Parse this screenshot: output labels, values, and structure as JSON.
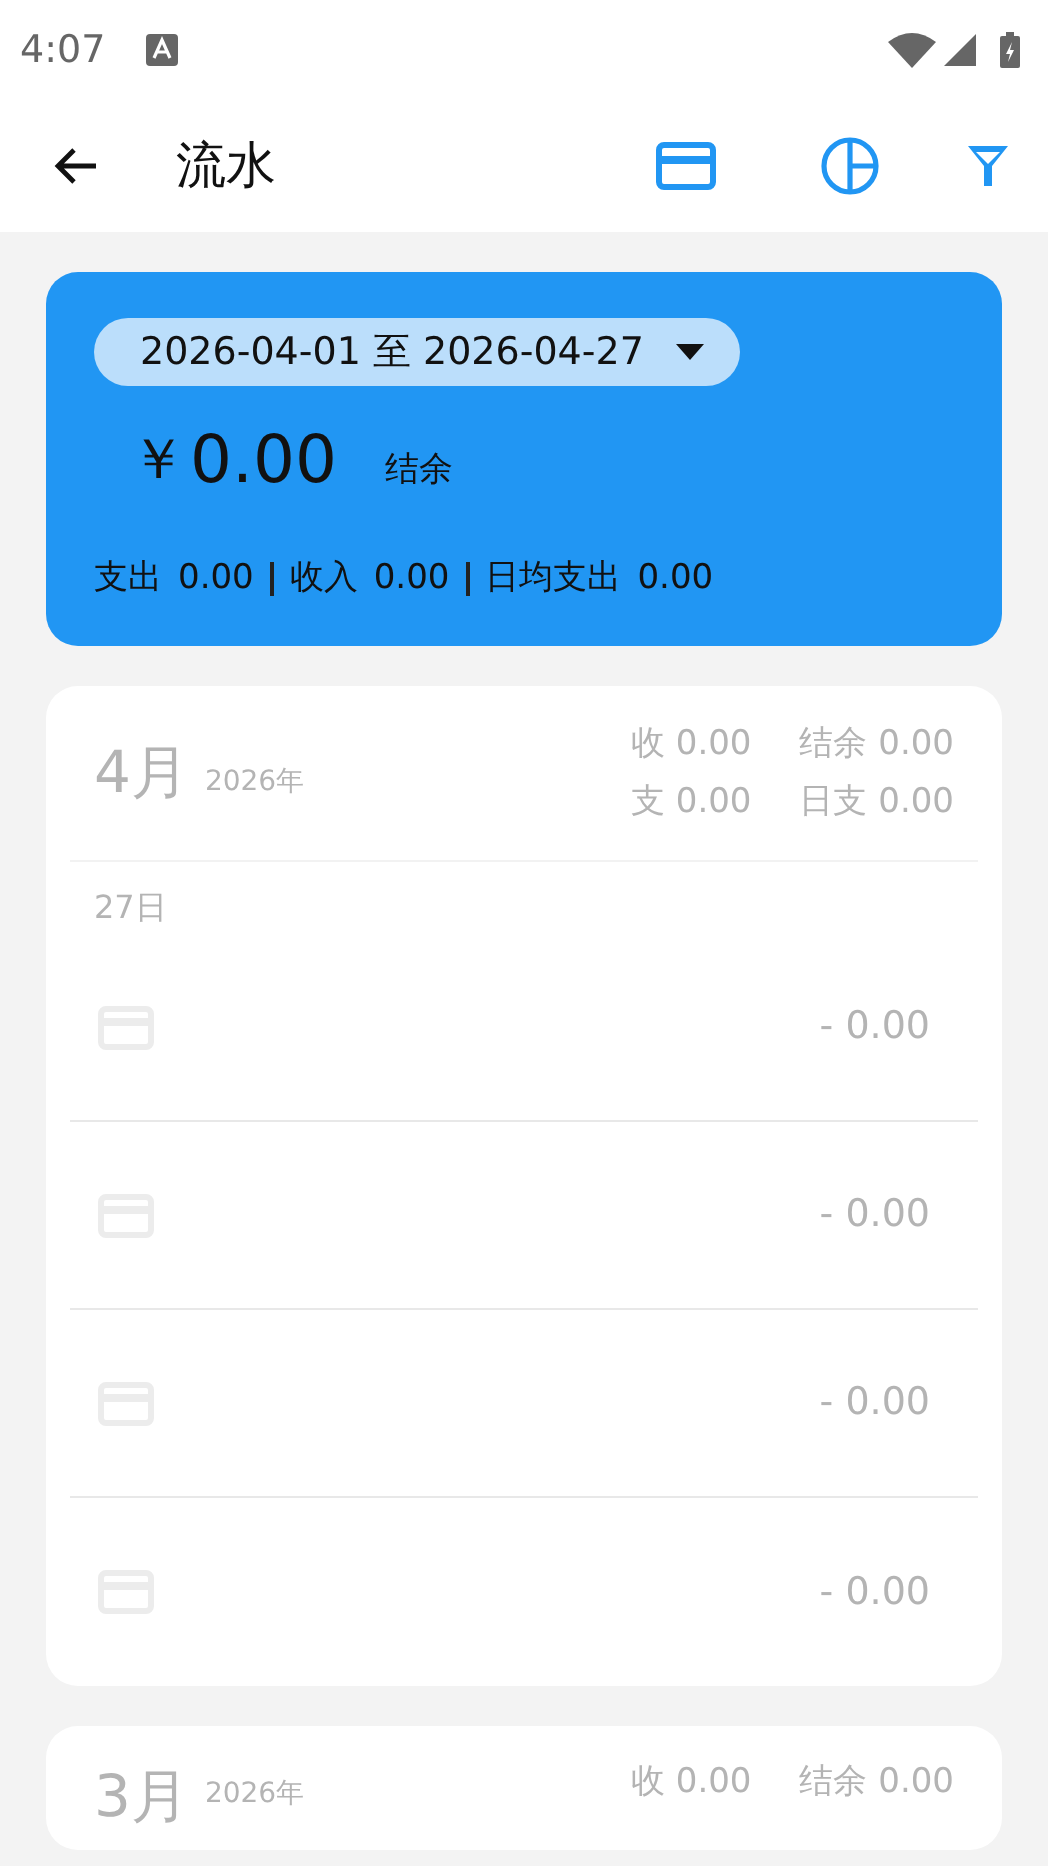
{
  "status_bar": {
    "time": "4:07"
  },
  "app_bar": {
    "title": "流水"
  },
  "summary": {
    "date_range": "2026-04-01 至 2026-04-27",
    "currency": "￥",
    "balance": "0.00",
    "balance_label": "结余",
    "stats": [
      {
        "label": "支出",
        "value": "0.00"
      },
      {
        "label": "收入",
        "value": "0.00"
      },
      {
        "label": "日均支出",
        "value": "0.00"
      }
    ]
  },
  "months": [
    {
      "month": "4月",
      "year": "2026年",
      "stats": [
        {
          "label": "收",
          "value": "0.00"
        },
        {
          "label": "结余",
          "value": "0.00"
        },
        {
          "label": "支",
          "value": "0.00"
        },
        {
          "label": "日支",
          "value": "0.00"
        }
      ],
      "days": [
        {
          "day": "27日",
          "entries": [
            {
              "amount": "- 0.00"
            },
            {
              "amount": "- 0.00"
            },
            {
              "amount": "- 0.00"
            },
            {
              "amount": "- 0.00"
            }
          ]
        }
      ]
    },
    {
      "month": "3月",
      "year": "2026年",
      "stats": [
        {
          "label": "收",
          "value": "0.00"
        },
        {
          "label": "结余",
          "value": "0.00"
        }
      ]
    }
  ]
}
